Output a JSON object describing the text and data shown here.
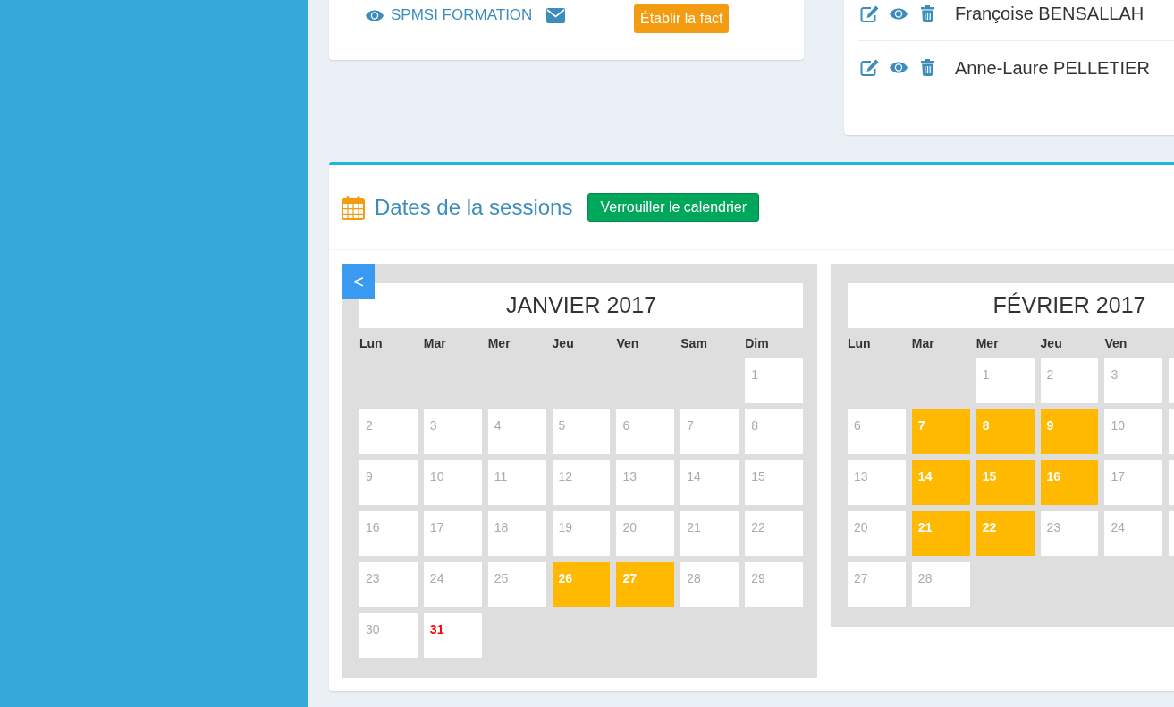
{
  "info_card": {
    "link": "SPMSI FORMATION",
    "invoice_button": "Établir la fact"
  },
  "participants": [
    {
      "name": "Françoise BENSALLAH"
    },
    {
      "name": "Anne-Laure PELLETIER"
    }
  ],
  "sessions": {
    "title": "Dates de la sessions",
    "lock_button": "Verrouiller le calendrier",
    "prev_button": "<",
    "months": [
      {
        "title": "JANVIER 2017",
        "weekdays": [
          "Lun",
          "Mar",
          "Mer",
          "Jeu",
          "Ven",
          "Sam",
          "Dim"
        ],
        "weeks": [
          [
            {
              "kind": "gap"
            },
            {
              "kind": "gap"
            },
            {
              "kind": "gap"
            },
            {
              "kind": "gap"
            },
            {
              "kind": "gap"
            },
            {
              "kind": "gap"
            },
            {
              "kind": "day",
              "day": "1",
              "selected": false,
              "today": false
            }
          ],
          [
            {
              "kind": "day",
              "day": "2",
              "selected": false,
              "today": false
            },
            {
              "kind": "day",
              "day": "3",
              "selected": false,
              "today": false
            },
            {
              "kind": "day",
              "day": "4",
              "selected": false,
              "today": false
            },
            {
              "kind": "day",
              "day": "5",
              "selected": false,
              "today": false
            },
            {
              "kind": "day",
              "day": "6",
              "selected": false,
              "today": false
            },
            {
              "kind": "day",
              "day": "7",
              "selected": false,
              "today": false
            },
            {
              "kind": "day",
              "day": "8",
              "selected": false,
              "today": false
            }
          ],
          [
            {
              "kind": "day",
              "day": "9",
              "selected": false,
              "today": false
            },
            {
              "kind": "day",
              "day": "10",
              "selected": false,
              "today": false
            },
            {
              "kind": "day",
              "day": "11",
              "selected": false,
              "today": false
            },
            {
              "kind": "day",
              "day": "12",
              "selected": false,
              "today": false
            },
            {
              "kind": "day",
              "day": "13",
              "selected": false,
              "today": false
            },
            {
              "kind": "day",
              "day": "14",
              "selected": false,
              "today": false
            },
            {
              "kind": "day",
              "day": "15",
              "selected": false,
              "today": false
            }
          ],
          [
            {
              "kind": "day",
              "day": "16",
              "selected": false,
              "today": false
            },
            {
              "kind": "day",
              "day": "17",
              "selected": false,
              "today": false
            },
            {
              "kind": "day",
              "day": "18",
              "selected": false,
              "today": false
            },
            {
              "kind": "day",
              "day": "19",
              "selected": false,
              "today": false
            },
            {
              "kind": "day",
              "day": "20",
              "selected": false,
              "today": false
            },
            {
              "kind": "day",
              "day": "21",
              "selected": false,
              "today": false
            },
            {
              "kind": "day",
              "day": "22",
              "selected": false,
              "today": false
            }
          ],
          [
            {
              "kind": "day",
              "day": "23",
              "selected": false,
              "today": false
            },
            {
              "kind": "day",
              "day": "24",
              "selected": false,
              "today": false
            },
            {
              "kind": "day",
              "day": "25",
              "selected": false,
              "today": false
            },
            {
              "kind": "day",
              "day": "26",
              "selected": true,
              "today": false
            },
            {
              "kind": "day",
              "day": "27",
              "selected": true,
              "today": false
            },
            {
              "kind": "day",
              "day": "28",
              "selected": false,
              "today": false
            },
            {
              "kind": "day",
              "day": "29",
              "selected": false,
              "today": false
            }
          ],
          [
            {
              "kind": "day",
              "day": "30",
              "selected": false,
              "today": false
            },
            {
              "kind": "day",
              "day": "31",
              "selected": false,
              "today": true
            }
          ]
        ]
      },
      {
        "title": "FÉVRIER 2017",
        "weekdays": [
          "Lun",
          "Mar",
          "Mer",
          "Jeu",
          "Ven"
        ],
        "weeks": [
          [
            {
              "kind": "gap"
            },
            {
              "kind": "gap"
            },
            {
              "kind": "day",
              "day": "1",
              "selected": false,
              "today": false
            },
            {
              "kind": "day",
              "day": "2",
              "selected": false,
              "today": false
            },
            {
              "kind": "day",
              "day": "3",
              "selected": false,
              "today": false
            },
            {
              "kind": "edge"
            }
          ],
          [
            {
              "kind": "day",
              "day": "6",
              "selected": false,
              "today": false
            },
            {
              "kind": "day",
              "day": "7",
              "selected": true,
              "today": false
            },
            {
              "kind": "day",
              "day": "8",
              "selected": true,
              "today": false
            },
            {
              "kind": "day",
              "day": "9",
              "selected": true,
              "today": false
            },
            {
              "kind": "day",
              "day": "10",
              "selected": false,
              "today": false
            },
            {
              "kind": "edge"
            }
          ],
          [
            {
              "kind": "day",
              "day": "13",
              "selected": false,
              "today": false
            },
            {
              "kind": "day",
              "day": "14",
              "selected": true,
              "today": false
            },
            {
              "kind": "day",
              "day": "15",
              "selected": true,
              "today": false
            },
            {
              "kind": "day",
              "day": "16",
              "selected": true,
              "today": false
            },
            {
              "kind": "day",
              "day": "17",
              "selected": false,
              "today": false
            },
            {
              "kind": "edge"
            }
          ],
          [
            {
              "kind": "day",
              "day": "20",
              "selected": false,
              "today": false
            },
            {
              "kind": "day",
              "day": "21",
              "selected": true,
              "today": false
            },
            {
              "kind": "day",
              "day": "22",
              "selected": true,
              "today": false
            },
            {
              "kind": "day",
              "day": "23",
              "selected": false,
              "today": false
            },
            {
              "kind": "day",
              "day": "24",
              "selected": false,
              "today": false
            },
            {
              "kind": "edge"
            }
          ],
          [
            {
              "kind": "day",
              "day": "27",
              "selected": false,
              "today": false
            },
            {
              "kind": "day",
              "day": "28",
              "selected": false,
              "today": false
            }
          ]
        ]
      }
    ]
  }
}
